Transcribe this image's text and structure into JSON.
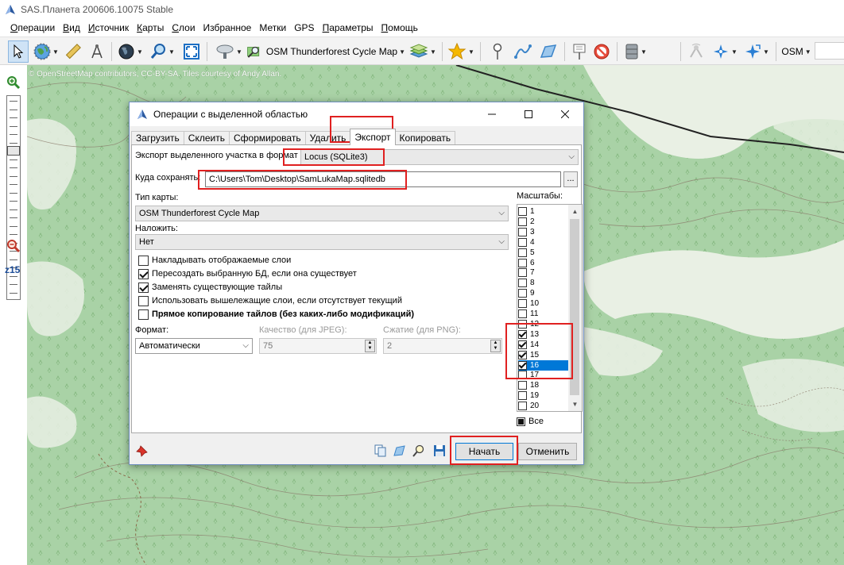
{
  "window": {
    "title": "SAS.Планета 200606.10075 Stable"
  },
  "menu": {
    "items": [
      {
        "label": "Операции",
        "ul": "О",
        "rest": "перации"
      },
      {
        "label": "Вид",
        "ul": "В",
        "rest": "ид"
      },
      {
        "label": "Источник",
        "ul": "И",
        "rest": "сточник"
      },
      {
        "label": "Карты",
        "ul": "К",
        "rest": "арты"
      },
      {
        "label": "Слои",
        "ul": "С",
        "rest": "лои"
      },
      {
        "label": "Избранное",
        "ul": "",
        "rest": "Избранное"
      },
      {
        "label": "Метки",
        "ul": "",
        "rest": "Метки"
      },
      {
        "label": "GPS",
        "ul": "",
        "rest": "GPS"
      },
      {
        "label": "Параметры",
        "ul": "П",
        "rest": "араметры"
      },
      {
        "label": "Помощь",
        "ul": "П",
        "rest": "омощь"
      }
    ]
  },
  "toolbar": {
    "map_label": "OSM Thunderforest Cycle Map",
    "source_label": "OSM",
    "icons": [
      "cursor-icon",
      "globe-icon",
      "ruler-icon",
      "compass-icon",
      "dark-globe-icon",
      "magnifier-icon",
      "fullscreen-icon",
      "satellite-icon",
      "map-search-icon",
      "layers-icon",
      "star-icon",
      "placemark-icon",
      "path-icon",
      "polygon-icon",
      "mark-info-icon",
      "no-entry-icon",
      "database-icon",
      "gps-dish-icon",
      "gps-blue-icon",
      "gps-arrow-icon"
    ]
  },
  "zoom": {
    "label": "z15"
  },
  "map": {
    "attribution": "© OpenStreetMap contributors, CC-BY-SA. Tiles courtesy of Andy Allan.",
    "colors": {
      "forest": "#a9d2a6",
      "clearing": "#e9f0e4",
      "contour": "#8a7a6a",
      "road": "#222222"
    }
  },
  "dialog": {
    "title": "Операции с выделенной областью",
    "tabs": [
      "Загрузить",
      "Склеить",
      "Сформировать",
      "Удалить",
      "Экспорт",
      "Копировать"
    ],
    "active_tab": "Экспорт",
    "export_label": "Экспорт выделенного участка в формат",
    "export_format": "Locus (SQLite3)",
    "save_label": "Куда сохранять:",
    "save_path": "C:\\Users\\Tom\\Desktop\\SamLukaMap.sqlitedb",
    "browse_label": "...",
    "map_type_label": "Тип карты:",
    "map_type_value": "OSM Thunderforest Cycle Map",
    "overlay_label": "Наложить:",
    "overlay_value": "Нет",
    "checkboxes": [
      {
        "label": "Накладывать отображаемые слои",
        "checked": false
      },
      {
        "label": "Пересоздать выбранную БД, если она существует",
        "checked": true
      },
      {
        "label": "Заменять существующие тайлы",
        "checked": true
      },
      {
        "label": "Использовать вышележащие слои, если отсутствует текущий",
        "checked": false
      },
      {
        "label": "Прямое копирование тайлов (без каких-либо модификаций)",
        "checked": false,
        "bold": true
      }
    ],
    "format_label": "Формат:",
    "format_value": "Автоматически",
    "quality_label": "Качество (для JPEG):",
    "quality_value": "75",
    "compression_label": "Сжатие (для PNG):",
    "compression_value": "2",
    "scales_label": "Масштабы:",
    "scales": [
      {
        "z": "1",
        "checked": false
      },
      {
        "z": "2",
        "checked": false
      },
      {
        "z": "3",
        "checked": false
      },
      {
        "z": "4",
        "checked": false
      },
      {
        "z": "5",
        "checked": false
      },
      {
        "z": "6",
        "checked": false
      },
      {
        "z": "7",
        "checked": false
      },
      {
        "z": "8",
        "checked": false
      },
      {
        "z": "9",
        "checked": false
      },
      {
        "z": "10",
        "checked": false
      },
      {
        "z": "11",
        "checked": false
      },
      {
        "z": "12",
        "checked": false
      },
      {
        "z": "13",
        "checked": true
      },
      {
        "z": "14",
        "checked": true
      },
      {
        "z": "15",
        "checked": true
      },
      {
        "z": "16",
        "checked": true,
        "selected": true
      },
      {
        "z": "17",
        "checked": false
      },
      {
        "z": "18",
        "checked": false
      },
      {
        "z": "19",
        "checked": false
      },
      {
        "z": "20",
        "checked": false
      }
    ],
    "all_label": "Все",
    "start_button": "Начать",
    "cancel_button": "Отменить"
  }
}
